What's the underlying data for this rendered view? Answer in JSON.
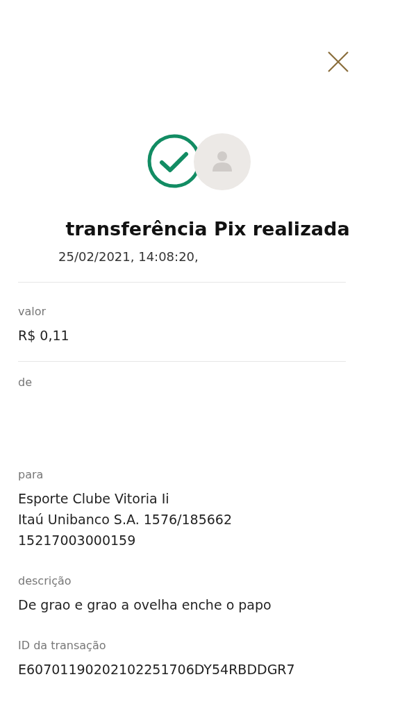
{
  "title": "transferência Pix realizada",
  "datetime": "25/02/2021, 14:08:20,",
  "fields": [
    {
      "kind": "divided",
      "label": "valor",
      "lines": [
        "R$ 0,11"
      ]
    },
    {
      "kind": "redacted",
      "label": "de"
    },
    {
      "kind": "plain",
      "label": "para",
      "lines": [
        "Esporte Clube Vitoria Ii",
        "Itaú Unibanco S.A. 1576/185662",
        "15217003000159"
      ]
    },
    {
      "kind": "plain",
      "label": "descrição",
      "lines": [
        "De grao e grao a ovelha enche o papo"
      ]
    },
    {
      "kind": "plain",
      "label": "ID da transação",
      "lines": [
        "E60701190202102251706DY54RBDDGR7"
      ]
    }
  ]
}
